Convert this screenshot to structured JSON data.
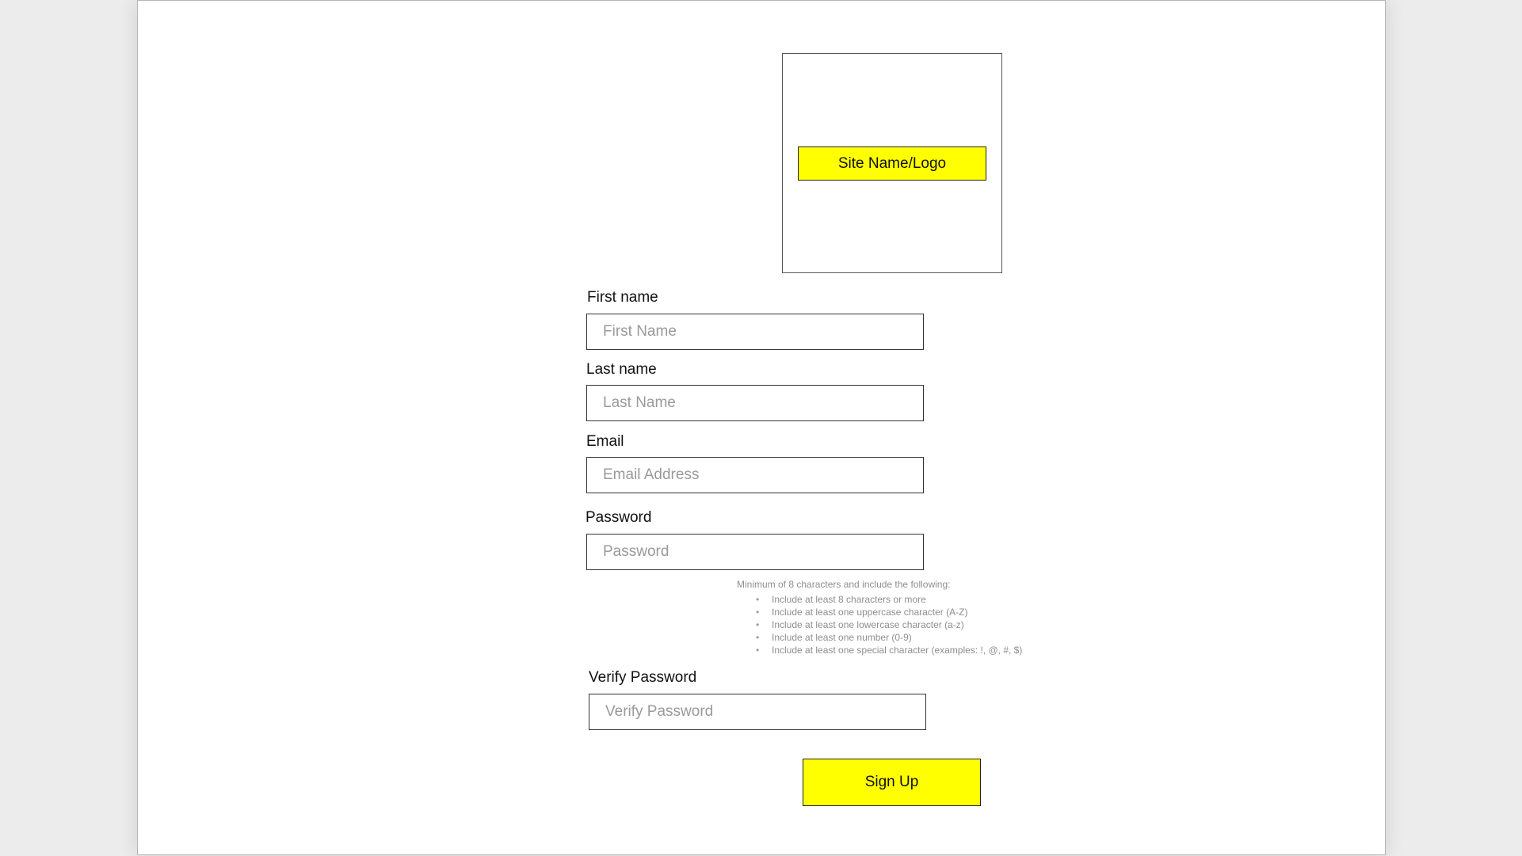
{
  "colors": {
    "accent": "#ffff00",
    "page_bg": "#ffffff",
    "outer_bg": "#ececec"
  },
  "logo": {
    "label": "Site Name/Logo"
  },
  "form": {
    "first_name": {
      "label": "First name",
      "placeholder": "First Name"
    },
    "last_name": {
      "label": "Last name",
      "placeholder": "Last Name"
    },
    "email": {
      "label": "Email",
      "placeholder": "Email Address"
    },
    "password": {
      "label": "Password",
      "placeholder": "Password",
      "hint_title": "Minimum of 8 characters and include the following:",
      "rules": [
        "Include at least 8 characters or more",
        "Include at least one uppercase character (A-Z)",
        "Include at least one lowercase character (a-z)",
        "Include at least one number (0-9)",
        "Include at least one special character (examples: !, @, #, $)"
      ]
    },
    "verify_password": {
      "label": "Verify Password",
      "placeholder": "Verify Password"
    },
    "submit_label": "Sign Up"
  }
}
